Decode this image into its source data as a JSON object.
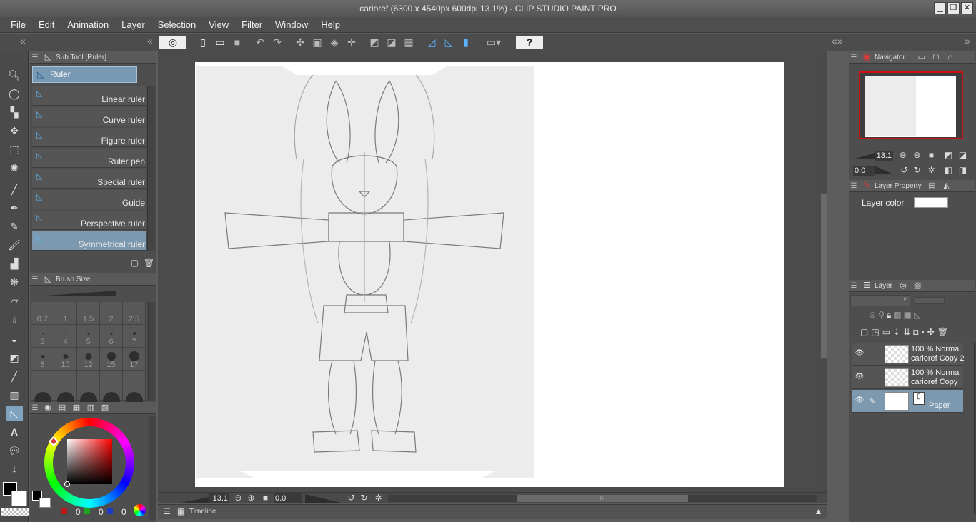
{
  "window": {
    "title": "carioref (6300 x 4540px 600dpi 13.1%)  - CLIP STUDIO PAINT PRO",
    "min_label": "▁",
    "max_label": "❐",
    "close_label": "✕"
  },
  "menu": [
    "File",
    "Edit",
    "Animation",
    "Layer",
    "Selection",
    "View",
    "Filter",
    "Window",
    "Help"
  ],
  "command_bar": {
    "help_label": "?"
  },
  "sub_tool": {
    "tab_label": "Sub Tool [Ruler]",
    "group_label": "Ruler",
    "items": [
      "Linear ruler",
      "Curve ruler",
      "Figure ruler",
      "Ruler pen",
      "Special ruler",
      "Guide",
      "Perspective ruler",
      "Symmetrical ruler"
    ],
    "active_item": "Symmetrical ruler"
  },
  "brush_size": {
    "tab_label": "Brush Size",
    "sizes": [
      "0.7",
      "1",
      "1.5",
      "2",
      "2.5",
      "3",
      "4",
      "5",
      "6",
      "7",
      "8",
      "10",
      "12",
      "15",
      "17"
    ]
  },
  "color": {
    "r": "0",
    "g": "0",
    "b": "0",
    "main_color": "#000000",
    "sub_color": "#ffffff",
    "picked_color": "#d43a3a"
  },
  "canvas": {
    "zoom": "13.1",
    "rotation": "0.0",
    "scroll_label": "III"
  },
  "timeline": {
    "tab_label": "Timeline"
  },
  "navigator": {
    "tab_label": "Navigator",
    "zoom": "13.1",
    "rotation": "0.0"
  },
  "layer_property": {
    "tab_label": "Layer Property",
    "layer_color_label": "Layer color",
    "layer_color_value": "#ffffff"
  },
  "layers": {
    "tab_label": "Layer",
    "items": [
      {
        "line1": "100 % Normal",
        "line2": "carioref Copy 2"
      },
      {
        "line1": "100 % Normal",
        "line2": "carioref Copy"
      },
      {
        "line1": "",
        "line2": "Paper"
      }
    ]
  }
}
